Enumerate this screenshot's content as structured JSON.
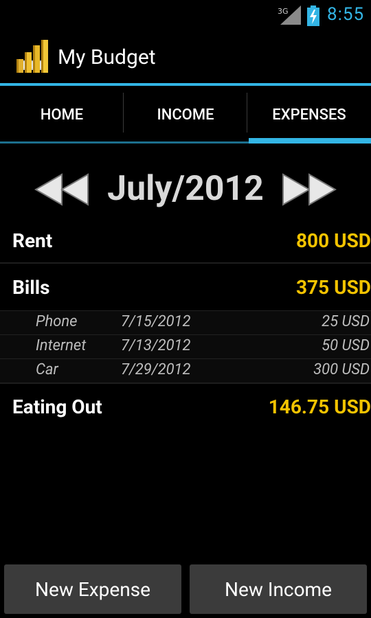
{
  "status_bar": {
    "network": "3G",
    "time": "8:55",
    "accent_color": "#33b5e5"
  },
  "action_bar": {
    "title": "My Budget",
    "icon": "budget-coins-icon"
  },
  "tabs": [
    {
      "label": "HOME",
      "selected": false
    },
    {
      "label": "INCOME",
      "selected": false
    },
    {
      "label": "EXPENSES",
      "selected": true
    }
  ],
  "month_nav": {
    "month": "July/2012",
    "prev_icon": "rewind-icon",
    "next_icon": "fast-forward-icon"
  },
  "categories": [
    {
      "name": "Rent",
      "amount": "800 USD"
    },
    {
      "name": "Bills",
      "amount": "375 USD",
      "items": [
        {
          "name": "Phone",
          "date": "7/15/2012",
          "amount": "25 USD"
        },
        {
          "name": "Internet",
          "date": "7/13/2012",
          "amount": "50 USD"
        },
        {
          "name": "Car",
          "date": "7/29/2012",
          "amount": "300 USD"
        }
      ]
    },
    {
      "name": "Eating Out",
      "amount": "146.75 USD"
    }
  ],
  "buttons": {
    "new_expense": "New Expense",
    "new_income": "New Income"
  },
  "colors": {
    "amount": "#f3c300",
    "accent": "#33b5e5",
    "background": "#000000"
  }
}
